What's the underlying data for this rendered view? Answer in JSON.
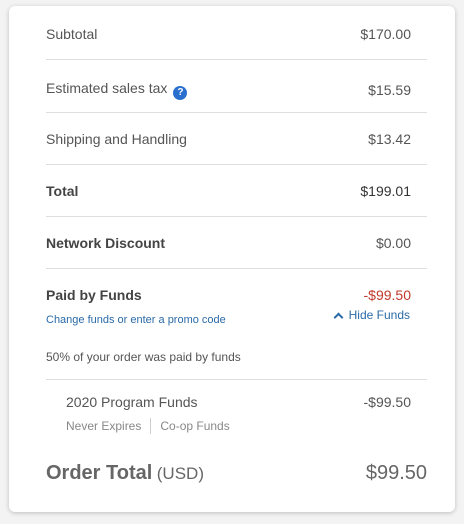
{
  "summary": {
    "subtotal": {
      "label": "Subtotal",
      "value": "$170.00"
    },
    "tax": {
      "label": "Estimated sales tax",
      "value": "$15.59",
      "icon": "help-icon"
    },
    "shipping": {
      "label": "Shipping and Handling",
      "value": "$13.42"
    },
    "total": {
      "label": "Total",
      "value": "$199.01"
    },
    "network_discount": {
      "label": "Network Discount",
      "value": "$0.00"
    }
  },
  "funds": {
    "label": "Paid by Funds",
    "value": "-$99.50",
    "change_link": "Change funds or enter a promo code",
    "hide_label": "Hide Funds",
    "note": "50% of your order was paid by funds",
    "item": {
      "name": "2020 Program Funds",
      "value": "-$99.50",
      "tags": [
        "Never Expires",
        "Co-op Funds"
      ]
    }
  },
  "order_total": {
    "label": "Order Total",
    "currency": "(USD)",
    "value": "$99.50"
  },
  "colors": {
    "negative": "#c0392b",
    "link": "#2a6aa8",
    "help_icon": "#2a6fcd"
  }
}
